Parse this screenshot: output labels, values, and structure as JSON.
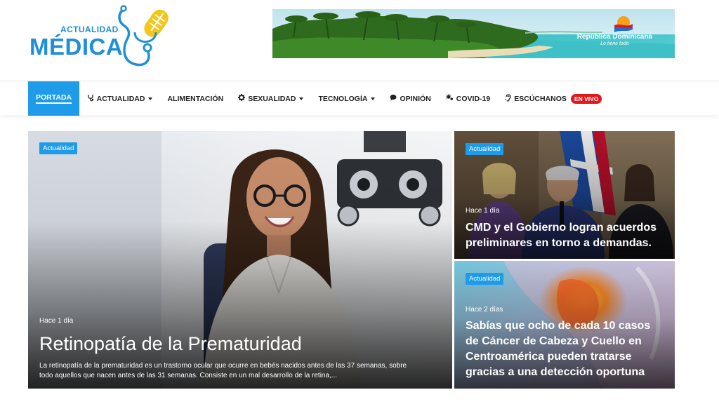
{
  "logo": {
    "line1": "ACTUALIDAD",
    "line2": "MÉDICA"
  },
  "banner": {
    "brand": "República Dominicana",
    "slogan": "Lo tiene todo"
  },
  "nav": {
    "items": [
      {
        "label": "PORTADA",
        "icon": "",
        "dropdown": false,
        "active": true
      },
      {
        "label": "ACTUALIDAD",
        "icon": "stethoscope-icon",
        "dropdown": true,
        "active": false
      },
      {
        "label": "ALIMENTACIÓN",
        "icon": "",
        "dropdown": false,
        "active": false
      },
      {
        "label": "SEXUALIDAD",
        "icon": "gear-icon",
        "dropdown": true,
        "active": false
      },
      {
        "label": "TECNOLOGÍA",
        "icon": "",
        "dropdown": true,
        "active": false
      },
      {
        "label": "OPINIÓN",
        "icon": "comment-icon",
        "dropdown": false,
        "active": false
      },
      {
        "label": "COVID-19",
        "icon": "virus-icon",
        "dropdown": false,
        "active": false
      },
      {
        "label": "ESCÚCHANOS",
        "icon": "ear-icon",
        "dropdown": false,
        "active": false
      }
    ],
    "live_badge": "EN VIVO"
  },
  "featured": {
    "category": "Actualidad",
    "time": "Hace 1 día",
    "title": "Retinopatía de la Prematuridad",
    "excerpt_line1": "La retinopatía de la prematuridad es un trastorno ocular que ocurre en bebés nacidos antes de las 37 semanas, sobre",
    "excerpt_line2": "todo aquellos que nacen antes de las 31 semanas. Consiste en un mal desarrollo de la retina,..."
  },
  "side_top": {
    "category": "Actualidad",
    "time": "Hace 1 día",
    "title_line1": "CMD y el Gobierno logran acuerdos",
    "title_line2": "preliminares en torno a demandas."
  },
  "side_bottom": {
    "category": "Actualidad",
    "time": "Hace 2 días",
    "title_line1": "Sabías que ocho de cada 10 casos",
    "title_line2": "de Cáncer de Cabeza y Cuello en",
    "title_line3": "Centroamérica pueden tratarse",
    "title_line4": "gracias a una detección oportuna"
  },
  "colors": {
    "accent": "#1e9be9",
    "logo_blue": "#1f8fd6",
    "logo_yellow": "#f5c518",
    "live_red": "#e0191e"
  }
}
